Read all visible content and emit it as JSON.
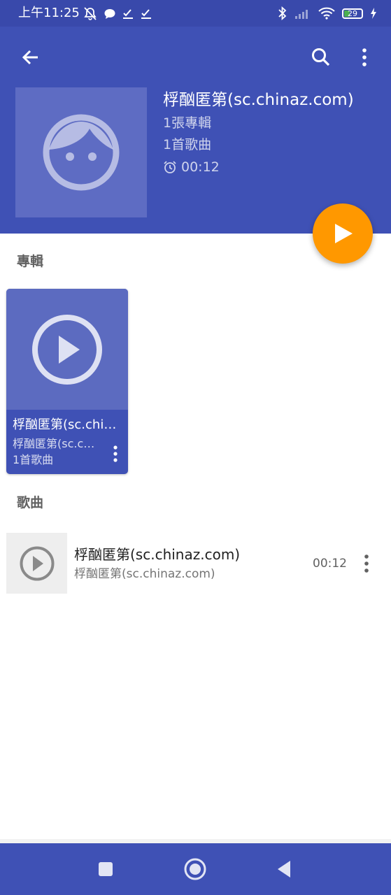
{
  "status_bar": {
    "time": "上午11:25",
    "battery_level": "29",
    "icons": [
      "do-not-disturb-icon",
      "chat-icon",
      "check-icon",
      "check-icon",
      "bluetooth-icon",
      "signal-icon",
      "wifi-icon",
      "battery-icon",
      "charging-icon"
    ]
  },
  "toolbar": {
    "back_icon": "arrow-back-icon",
    "search_icon": "search-icon",
    "more_icon": "more-vert-icon"
  },
  "artist": {
    "name": "桴酗匿第(sc.chinaz.com)",
    "albums": "1張專輯",
    "songs": "1首歌曲",
    "duration": "00:12"
  },
  "fab": {
    "icon": "play-icon"
  },
  "albums_section": {
    "title": "專輯",
    "items": [
      {
        "title": "桴酗匿第(sc.chinaz.com)",
        "artist": "桴酗匿第(sc.chinaz.com)",
        "count": "1首歌曲"
      }
    ]
  },
  "songs_section": {
    "title": "歌曲",
    "items": [
      {
        "title": "桴酗匿第(sc.chinaz.com)",
        "artist": "桴酗匿第(sc.chinaz.com)",
        "duration": "00:12"
      }
    ]
  },
  "colors": {
    "status_bar": "#3949ab",
    "header": "#3f51b5",
    "fab": "#ff9800",
    "album_art": "#5c6bc0"
  }
}
